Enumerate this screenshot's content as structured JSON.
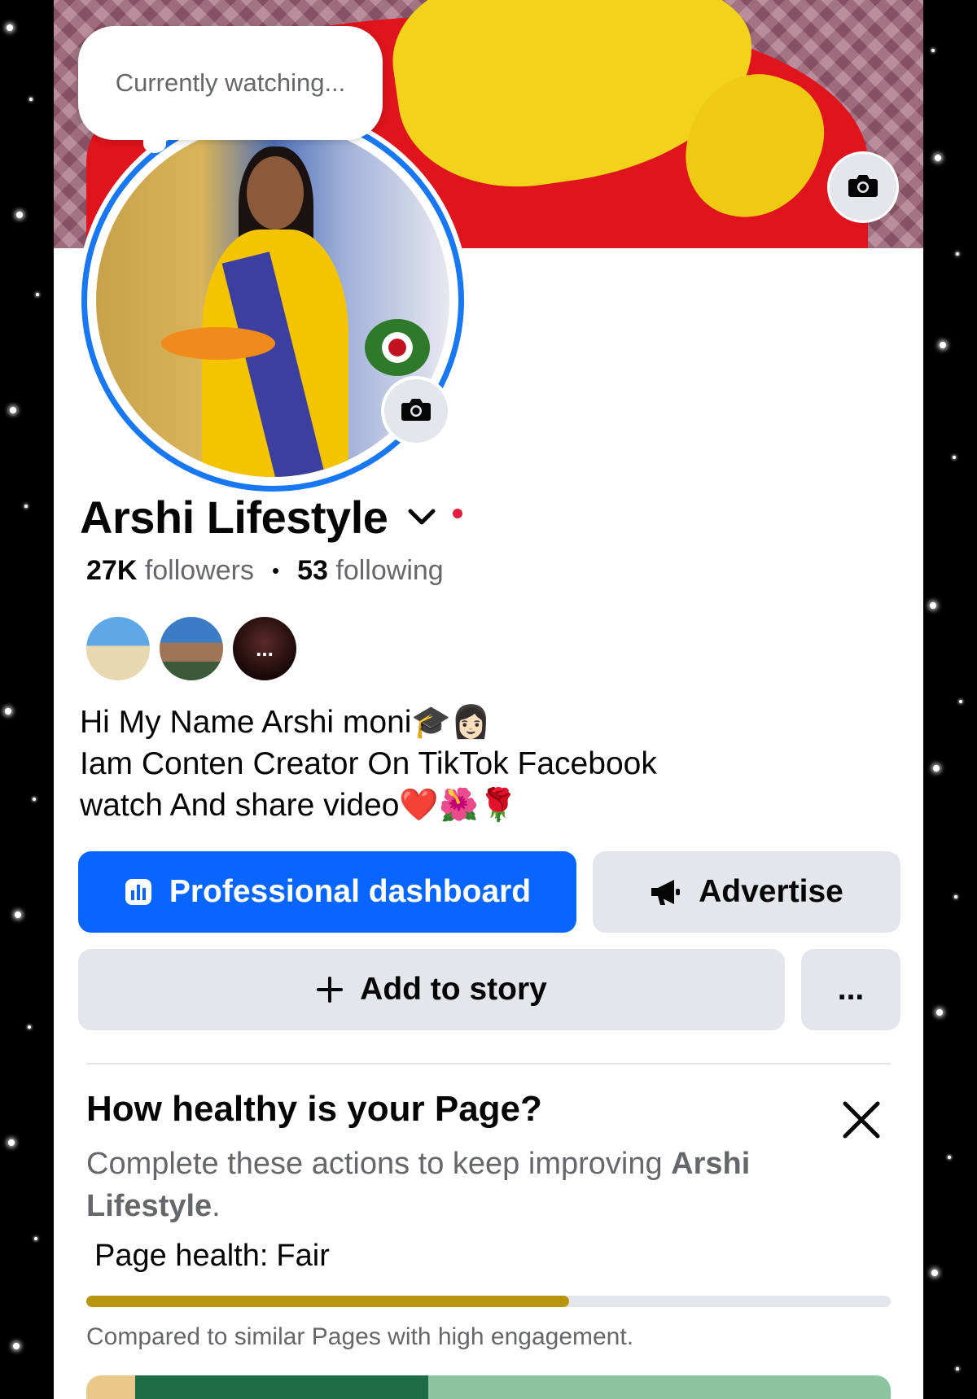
{
  "cover": {
    "camera_icon": "camera-icon"
  },
  "status_bubble": {
    "text": "Currently watching..."
  },
  "profile": {
    "name": "Arshi Lifestyle",
    "followers_count": "27K",
    "followers_label": "followers",
    "following_count": "53",
    "following_label": "following",
    "separator": "•",
    "friend_more_label": "...",
    "bio_lines": [
      "Hi My Name Arshi moni🎓👩🏻",
      "Iam Conten Creator On TikTok Facebook",
      "watch And share video❤️🌺🌹"
    ]
  },
  "actions": {
    "dashboard_label": "Professional dashboard",
    "advertise_label": "Advertise",
    "add_story_label": "Add to story",
    "more_label": "..."
  },
  "page_health": {
    "title": "How healthy is your Page?",
    "description_prefix": "Complete these actions to keep improving ",
    "description_page": "Arshi Lifestyle",
    "description_suffix": ".",
    "label": "Page health:",
    "status": "Fair",
    "progress": 0.6,
    "note": "Compared to similar Pages with high engagement."
  },
  "colors": {
    "accent": "#0866ff",
    "ring": "#1877f2",
    "health_bar": "#b8950f",
    "live_dot": "#e41e3f"
  }
}
